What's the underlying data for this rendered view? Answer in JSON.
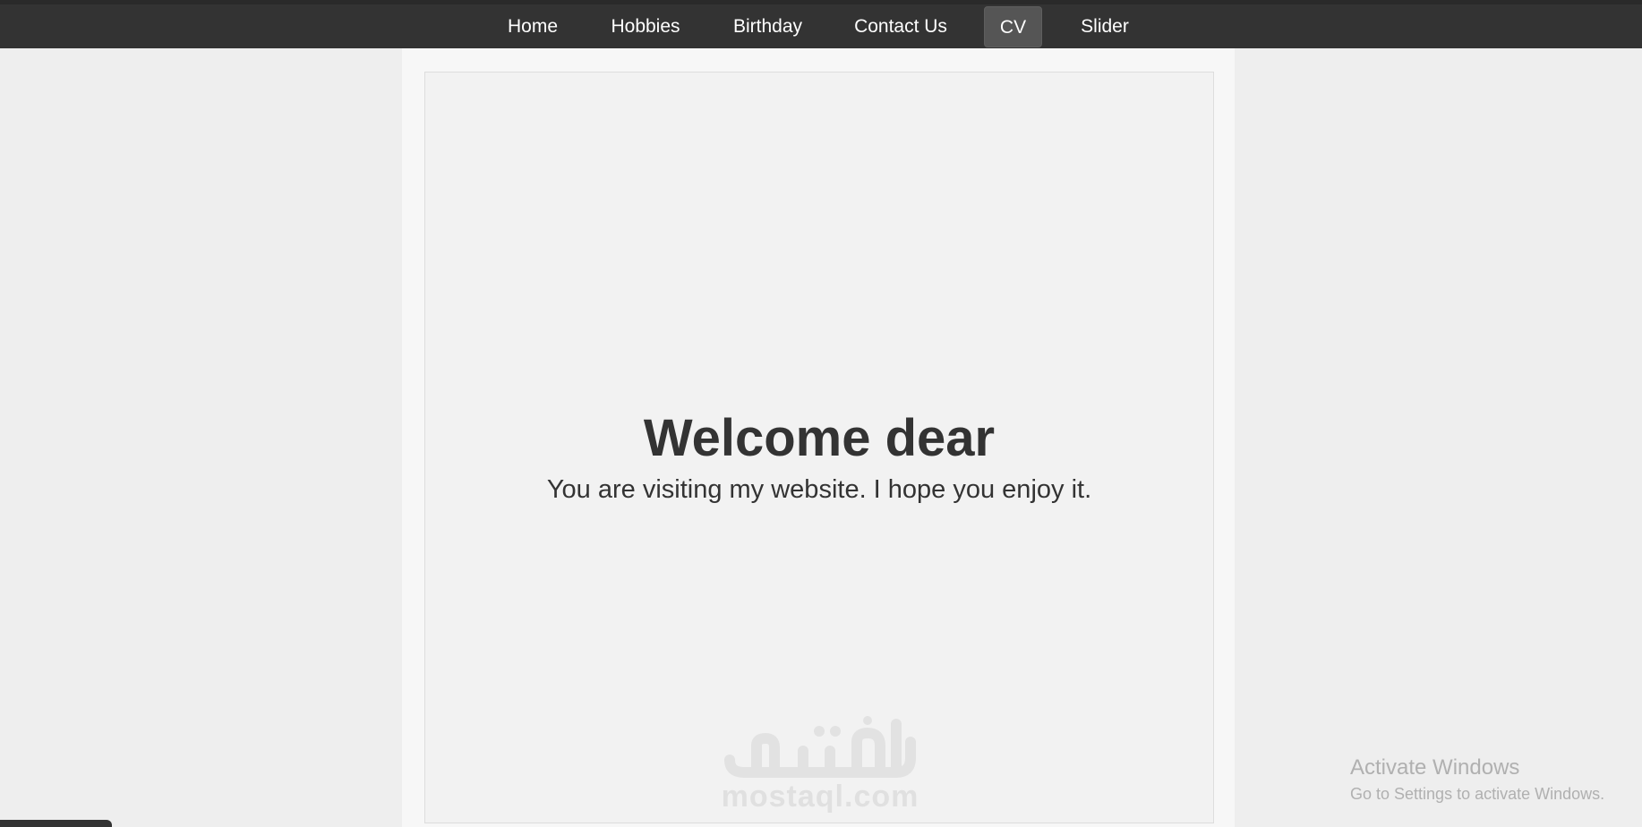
{
  "nav": {
    "items": [
      {
        "label": "Home"
      },
      {
        "label": "Hobbies"
      },
      {
        "label": "Birthday"
      },
      {
        "label": "Contact Us"
      },
      {
        "label": "CV",
        "active": true
      },
      {
        "label": "Slider"
      }
    ]
  },
  "hero": {
    "title": "Welcome dear",
    "subtitle": "You are visiting my website. I hope you enjoy it."
  },
  "watermark": {
    "domain": "mostaql.com"
  },
  "os_notice": {
    "title": "Activate Windows",
    "message": "Go to Settings to activate Windows."
  },
  "colors": {
    "navbar": "#333333",
    "active_tab": "#555555",
    "background": "#eeeeee",
    "panel": "#f2f2f2",
    "text": "#333333"
  }
}
